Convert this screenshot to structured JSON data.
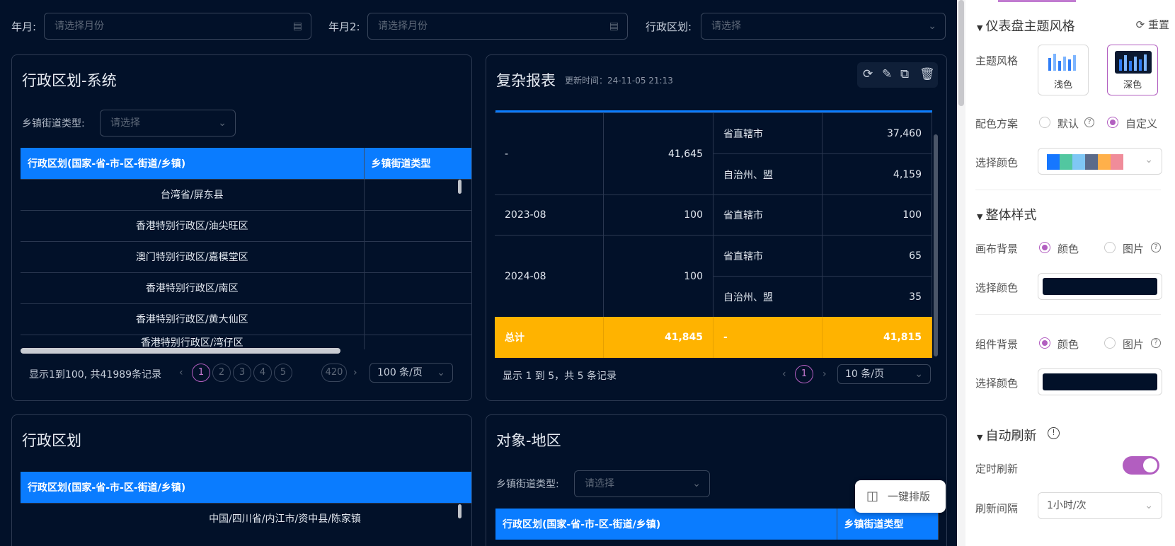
{
  "filters": {
    "month1_label": "年月:",
    "month1_placeholder": "请选择月份",
    "month2_label": "年月2:",
    "month2_placeholder": "请选择月份",
    "region_label": "行政区划:",
    "region_placeholder": "请选择"
  },
  "panel1": {
    "title": "行政区划-系统",
    "filter_label": "乡镇街道类型:",
    "filter_placeholder": "请选择",
    "columns": [
      "行政区划(国家-省-市-区-街道/乡镇)",
      "乡镇街道类型"
    ],
    "rows": [
      "台湾省/屏东县",
      "香港特别行政区/油尖旺区",
      "澳门特别行政区/嘉模堂区",
      "香港特别行政区/南区",
      "香港特别行政区/黄大仙区",
      "香港特别行政区/湾仔区"
    ],
    "summary": "显示1到100, 共41989条记录",
    "pages": [
      "1",
      "2",
      "3",
      "4",
      "5"
    ],
    "last_page": "420",
    "page_size": "100 条/页"
  },
  "panel2": {
    "title": "复杂报表",
    "updated": "更新时间：24-11-05 21:13",
    "rows": [
      {
        "month": "-",
        "total": "41,645",
        "sub": [
          {
            "type": "省直辖市",
            "value": "37,460"
          },
          {
            "type": "自治州、盟",
            "value": "4,159"
          }
        ]
      },
      {
        "month": "2023-08",
        "total": "100",
        "sub": [
          {
            "type": "省直辖市",
            "value": "100"
          }
        ]
      },
      {
        "month": "2024-08",
        "total": "100",
        "sub": [
          {
            "type": "省直辖市",
            "value": "65"
          },
          {
            "type": "自治州、盟",
            "value": "35"
          }
        ]
      }
    ],
    "total_row": {
      "label": "总计",
      "total": "41,845",
      "type": "-",
      "value": "41,815"
    },
    "summary": "显示 1 到 5，共 5 条记录",
    "page": "1",
    "page_size": "10 条/页"
  },
  "panel3": {
    "title": "行政区划",
    "column": "行政区划(国家-省-市-区-街道/乡镇)",
    "rows": [
      "中国/四川省/内江市/资中县/陈家镇"
    ]
  },
  "panel4": {
    "title": "对象-地区",
    "filter_label": "乡镇街道类型:",
    "filter_placeholder": "请选择",
    "columns": [
      "行政区划(国家-省-市-区-街道/乡镇)",
      "乡镇街道类型"
    ]
  },
  "layout_button": "一键排版",
  "settings": {
    "theme_section": "仪表盘主题风格",
    "reset": "重置",
    "theme_label": "主题风格",
    "theme_light": "浅色",
    "theme_dark": "深色",
    "scheme_label": "配色方案",
    "scheme_default": "默认",
    "scheme_custom": "自定义",
    "color_label": "选择颜色",
    "palette": [
      "#1677ff",
      "#52c7a0",
      "#7fc7f5",
      "#5b6b8a",
      "#ffb04a",
      "#f08c9a"
    ],
    "overall_section": "整体样式",
    "canvas_bg_label": "画布背景",
    "option_color": "颜色",
    "option_image": "图片",
    "canvas_color": "#021129",
    "widget_bg_label": "组件背景",
    "widget_color": "#021129",
    "refresh_section": "自动刷新",
    "timed_refresh_label": "定时刷新",
    "interval_label": "刷新间隔",
    "interval_value": "1小时/次"
  }
}
